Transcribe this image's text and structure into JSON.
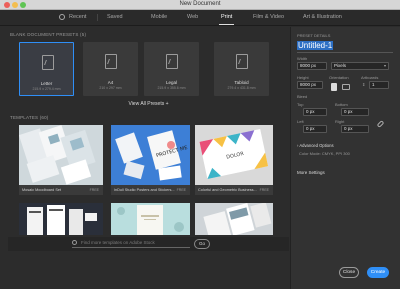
{
  "window": {
    "title": "New Document"
  },
  "tabs": [
    {
      "label": "Recent"
    },
    {
      "label": "Saved"
    },
    {
      "label": "Mobile"
    },
    {
      "label": "Web"
    },
    {
      "label": "Print",
      "active": true
    },
    {
      "label": "Film & Video"
    },
    {
      "label": "Art & Illustration"
    }
  ],
  "blank_presets": {
    "heading": "BLANK DOCUMENT PRESETS",
    "count": "(5)",
    "items": [
      {
        "name": "Letter",
        "dims": "215.9 x 279.4 mm"
      },
      {
        "name": "A4",
        "dims": "210 x 297 mm"
      },
      {
        "name": "Legal",
        "dims": "215.9 x 355.6 mm"
      },
      {
        "name": "Tabloid",
        "dims": "279.4 x 431.8 mm"
      }
    ],
    "view_all": "View All Presets +"
  },
  "templates": {
    "heading": "TEMPLATES",
    "count": "(60)",
    "items": [
      {
        "name": "Mosaic Moodboard Set",
        "badge": "FREE"
      },
      {
        "name": "InDull Studio Posters and Stickers...",
        "badge": "FREE"
      },
      {
        "name": "Colorful and Geometric Business...",
        "badge": "FREE"
      },
      {
        "name": ""
      },
      {
        "name": ""
      },
      {
        "name": ""
      }
    ],
    "thumb_texts": {
      "sticker": "PROTECT ME",
      "card": "DOLOR"
    }
  },
  "search": {
    "placeholder": "Find more templates on Adobe Stock",
    "go_label": "Go"
  },
  "details": {
    "heading": "PRESET DETAILS",
    "name": "Untitled-1",
    "width_label": "Width",
    "width_value": "8000 px",
    "units_value": "Pixels",
    "height_label": "Height",
    "height_value": "8000 px",
    "orientation_label": "Orientation",
    "artboards_label": "Artboards",
    "artboards_value": "1",
    "bleed_label": "Bleed",
    "top_label": "Top",
    "top_value": "0 px",
    "bottom_label": "Bottom",
    "bottom_value": "0 px",
    "left_label": "Left",
    "left_value": "0 px",
    "right_label": "Right",
    "right_value": "0 px",
    "advanced_label": "Advanced Options",
    "color_mode": "Color Mode: CMYK, PPI 300",
    "more_settings": "More Settings"
  },
  "footer": {
    "close_label": "Close",
    "create_label": "Create"
  },
  "colors": {
    "accent": "#2f8ff7",
    "panel_bg": "#2c2c2c",
    "details_bg": "#323232"
  }
}
